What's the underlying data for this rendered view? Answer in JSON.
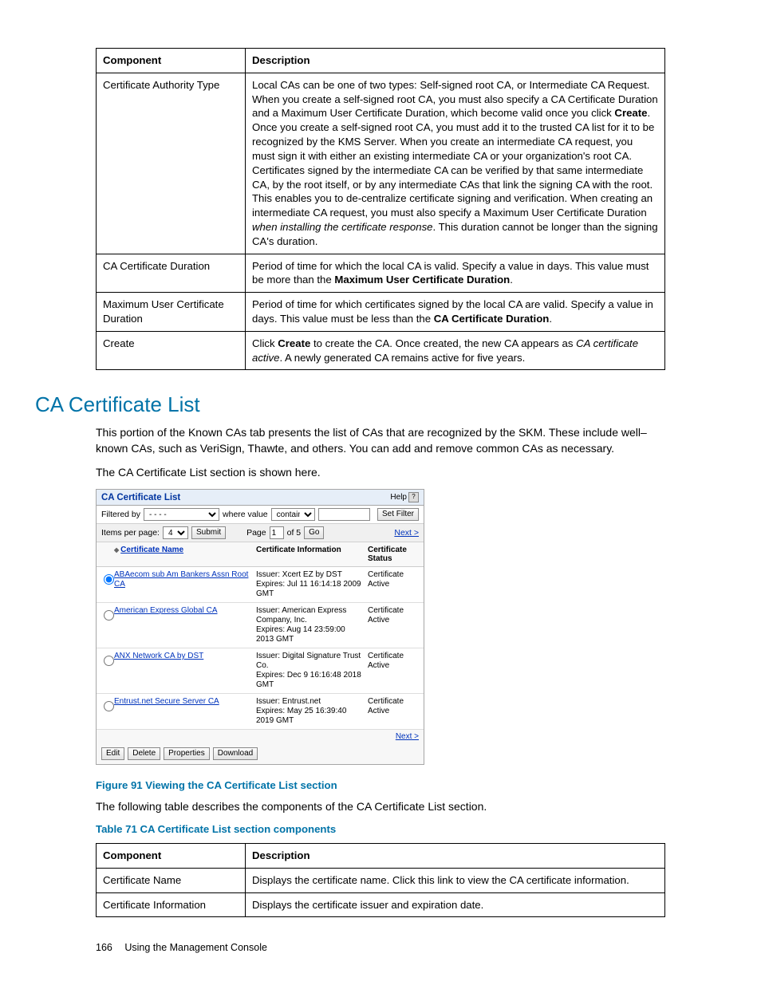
{
  "table1": {
    "h1": "Component",
    "h2": "Description",
    "rows": [
      {
        "c": "Certificate Authority Type",
        "d": "Local CAs can be one of two types: Self-signed root CA, or Intermediate CA Request. When you create a self-signed root CA, you must also specify a CA Certificate Duration and a Maximum User Certificate Duration, which become valid once you click <b>Create</b>. Once you create a self-signed root CA, you must add it to the trusted CA list for it to be recognized by the KMS Server. When you create an intermediate CA request, you must sign it with either an existing intermediate CA or your organization's root CA. Certificates signed by the intermediate CA can be verified by that same intermediate CA, by the root itself, or by any intermediate CAs that link the signing CA with the root. This enables you to de-centralize certificate signing and verification. When creating an intermediate CA request, you must also specify a Maximum User Certificate Duration <em>when installing the certificate response</em>. This duration cannot be longer than the signing CA's duration."
      },
      {
        "c": "CA Certificate Duration",
        "d": "Period of time for which the local CA is valid. Specify a value in days. This value must be more than the <b>Maximum User Certificate Duration</b>."
      },
      {
        "c": "Maximum User Certificate Duration",
        "d": "Period of time for which certificates signed by the local CA are valid. Specify a value in days. This value must be less than the <b>CA Certificate Duration</b>."
      },
      {
        "c": "Create",
        "d": "Click <b>Create</b> to create the CA. Once created, the new CA appears as <em>CA certificate active</em>. A newly generated CA remains active for five years."
      }
    ]
  },
  "section": {
    "heading": "CA Certificate List",
    "p1": "This portion of the Known CAs tab presents the list of CAs that are recognized by the SKM. These include well–known CAs, such as VeriSign, Thawte, and others. You can add and remove common CAs as necessary.",
    "p2": "The CA Certificate List section is shown here."
  },
  "panel": {
    "title": "CA Certificate List",
    "help": "Help",
    "filter_label": "Filtered by",
    "filter_sel": "- - - -",
    "where_label": "where value",
    "where_sel": "contains",
    "set_filter": "Set Filter",
    "ipp_label": "Items per page:",
    "ipp_sel": "4",
    "submit": "Submit",
    "page_label": "Page",
    "page_val": "1",
    "page_of": "of 5",
    "go": "Go",
    "next": "Next >",
    "col1": "Certificate Name",
    "col2": "Certificate Information",
    "col3": "Certificate Status",
    "rows": [
      {
        "name": "ABAecom sub Am Bankers Assn Root CA",
        "info": "Issuer: Xcert EZ by DST\nExpires: Jul 11 16:14:18 2009 GMT",
        "status": "Certificate Active",
        "checked": true
      },
      {
        "name": "American Express Global CA",
        "info": "Issuer: American Express Company, Inc.\nExpires: Aug 14 23:59:00 2013 GMT",
        "status": "Certificate Active",
        "checked": false
      },
      {
        "name": "ANX Network CA by DST",
        "info": "Issuer: Digital Signature Trust Co.\nExpires: Dec 9 16:16:48 2018 GMT",
        "status": "Certificate Active",
        "checked": false
      },
      {
        "name": "Entrust.net Secure Server CA",
        "info": "Issuer: Entrust.net\nExpires: May 25 16:39:40 2019 GMT",
        "status": "Certificate Active",
        "checked": false
      }
    ],
    "actions": {
      "edit": "Edit",
      "delete": "Delete",
      "properties": "Properties",
      "download": "Download"
    }
  },
  "fig_caption": "Figure 91 Viewing the CA Certificate List section",
  "p3": "The following table describes the components of the CA Certificate List section.",
  "tbl_caption": "Table 71 CA Certificate List section components",
  "table2": {
    "h1": "Component",
    "h2": "Description",
    "rows": [
      {
        "c": "Certificate Name",
        "d": "Displays the certificate name. Click this link to view the CA certificate information."
      },
      {
        "c": "Certificate Information",
        "d": "Displays the certificate issuer and expiration date."
      }
    ]
  },
  "footer": {
    "page": "166",
    "title": "Using the Management Console"
  }
}
